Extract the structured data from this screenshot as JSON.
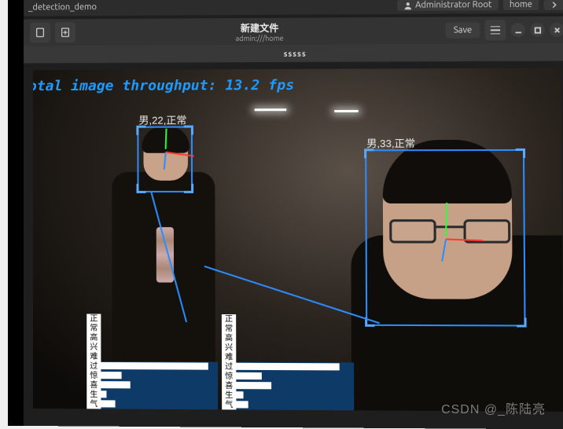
{
  "topbar": {
    "app_title": "_detection_demo",
    "user": "Administrator Root",
    "folder": "home"
  },
  "gedit": {
    "title_main": "新建文件",
    "title_sub": "admin:///home",
    "save_label": "Save"
  },
  "tab": {
    "label": "sssss"
  },
  "video": {
    "fps_text": "otal image throughput: 13.2 fps"
  },
  "detections": [
    {
      "label": "男,22,正常"
    },
    {
      "label": "男,33,正常"
    }
  ],
  "emotions": {
    "labels": [
      "正常",
      "高兴",
      "难过",
      "惊喜",
      "生气"
    ],
    "panels": [
      {
        "values": [
          0.92,
          0.18,
          0.25,
          0.05,
          0.12
        ]
      },
      {
        "values": [
          0.88,
          0.22,
          0.3,
          0.06,
          0.1
        ]
      }
    ]
  },
  "watermark": "CSDN @_陈陆亮"
}
